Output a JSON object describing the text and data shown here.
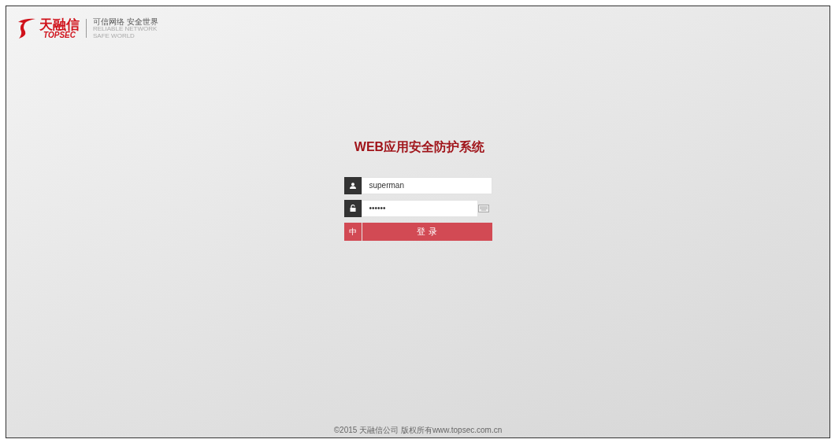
{
  "logo": {
    "name_cn": "天融信",
    "name_en": "TOPSEC",
    "slogan_cn": "可信网络 安全世界",
    "slogan_en_1": "RELIABLE NETWORK",
    "slogan_en_2": "SAFE WORLD"
  },
  "title": "WEB应用安全防护系统",
  "form": {
    "username": "superman",
    "password": "••••••",
    "language": "中",
    "login": "登 录"
  },
  "footer": "©2015 天融信公司 版权所有www.topsec.com.cn"
}
